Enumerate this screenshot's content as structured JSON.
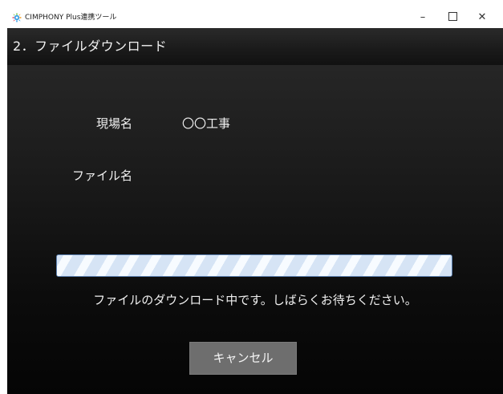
{
  "window": {
    "title": "CIMPHONY Plus連携ツール",
    "icon": "app-logo-icon",
    "controls": {
      "minimize": "–",
      "close": "✕"
    }
  },
  "header": {
    "step_title": "2．ファイルダウンロード"
  },
  "form": {
    "site_label": "現場名",
    "site_value": "〇〇工事",
    "file_label": "ファイル名",
    "file_value": ""
  },
  "progress": {
    "style": "marquee",
    "fill_fraction": 1.0,
    "status_text": "ファイルのダウンロード中です。しばらくお待ちください。"
  },
  "buttons": {
    "cancel_label": "キャンセル"
  }
}
